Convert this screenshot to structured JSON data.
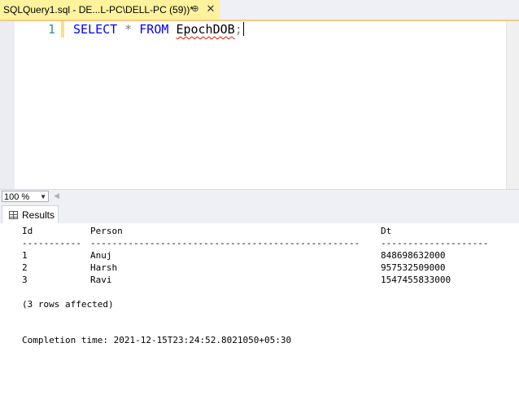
{
  "tab": {
    "title": "SQLQuery1.sql - DE...L-PC\\DELL-PC (59))*",
    "pin_glyph": "⊕",
    "close_glyph": "✕"
  },
  "editor": {
    "line_number": "1",
    "code": {
      "keyword1": "SELECT",
      "star": "*",
      "keyword2": "FROM",
      "table": "EpochDOB",
      "semicolon": ";"
    }
  },
  "zoom": {
    "value": "100 %"
  },
  "results_tab": {
    "label": "Results"
  },
  "results": {
    "columns": [
      "Id",
      "Person",
      "Dt"
    ],
    "separators": [
      "-----------",
      "--------------------------------------------------",
      "--------------------"
    ],
    "rows": [
      [
        "1",
        "Anuj",
        "848698632000"
      ],
      [
        "2",
        "Harsh",
        "957532509000"
      ],
      [
        "3",
        "Ravi",
        "1547455833000"
      ]
    ],
    "rows_affected": "(3 rows affected)",
    "completion": "Completion time: 2021-12-15T23:24:52.8021050+05:30"
  }
}
